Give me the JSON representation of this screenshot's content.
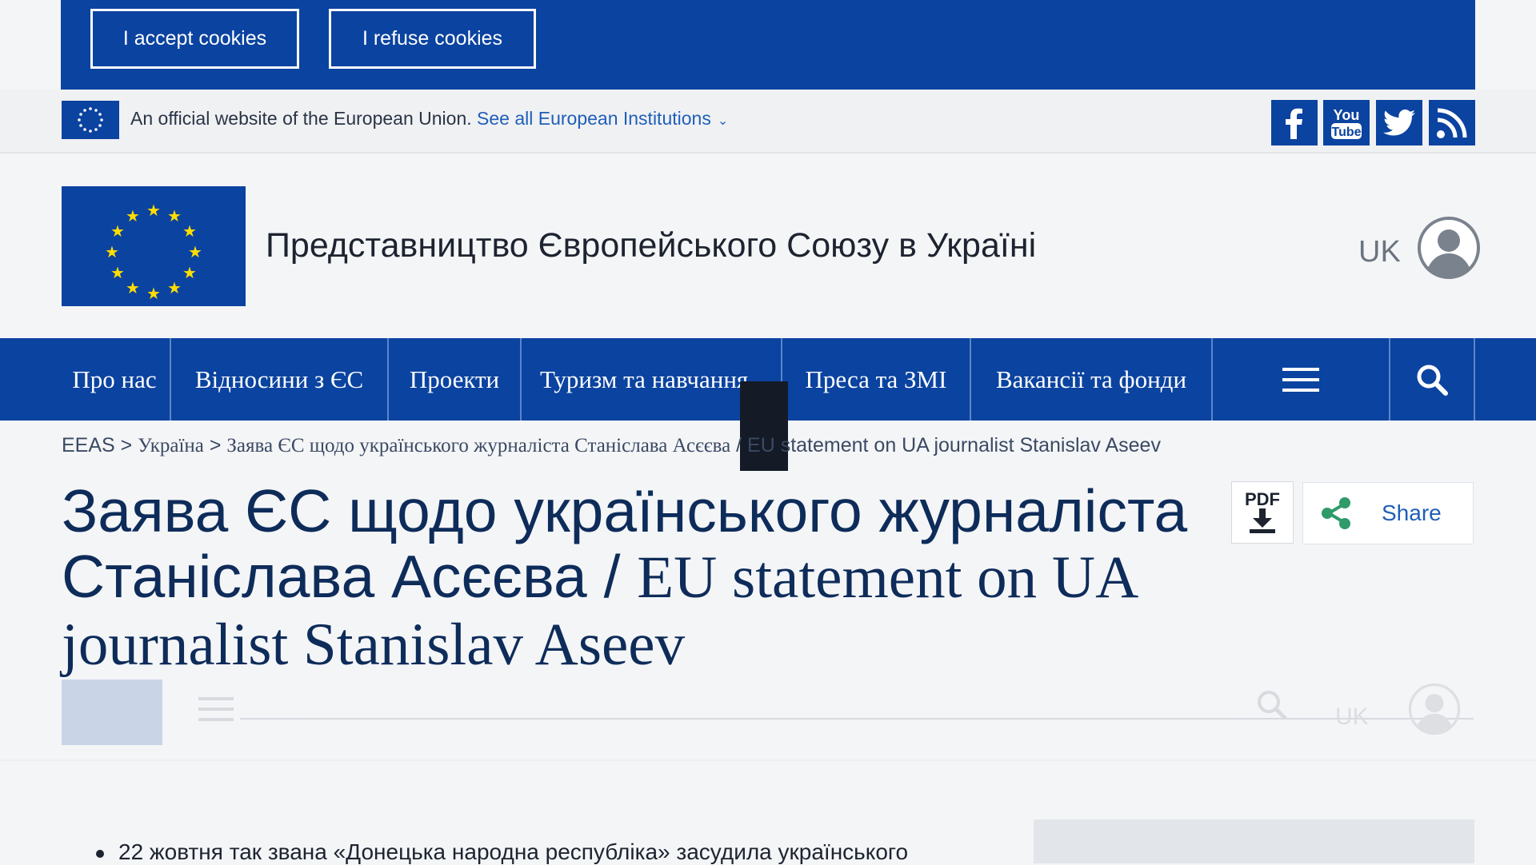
{
  "cookie_banner": {
    "accept_label": "I accept cookies",
    "refuse_label": "I refuse cookies"
  },
  "official_bar": {
    "text": "An official website of the European Union.",
    "link_label": "See all European Institutions"
  },
  "social": {
    "youtube_label_top": "You",
    "youtube_label_bottom": "Tube"
  },
  "header": {
    "site_title": "Представництво Європейського Союзу в Україні",
    "language": "UK"
  },
  "nav": {
    "items": [
      "Про нас",
      "Відносини з ЄС",
      "Проекти",
      "Туризм та навчання",
      "Преса та ЗМІ",
      "Вакансії та фонди"
    ]
  },
  "breadcrumb": {
    "root": "EEAS",
    "sep": " > ",
    "country": "Україна",
    "current_uk": "Заява ЄС щодо українського журналіста Станіслава Асєєва",
    "current_en": " / EU statement on UA journalist Stanislav Aseev"
  },
  "article": {
    "title_line1": "Заява ЄС щодо українського журналіста",
    "title_line2_uk": "Станіслава Асєєва / ",
    "title_line2_en": "EU statement on UA",
    "title_line3": "journalist Stanislav Aseev",
    "pdf_label": "PDF",
    "share_label": "Share",
    "bullet_1": "22 жовтня так звана «Донецька народна республіка» засудила українського"
  },
  "ghost_header": {
    "language": "UK"
  },
  "colors": {
    "eu_blue": "#0b43a0",
    "eu_yellow": "#ffdd00",
    "title_navy": "#0e2c5a",
    "link_blue": "#1f5fb8"
  }
}
